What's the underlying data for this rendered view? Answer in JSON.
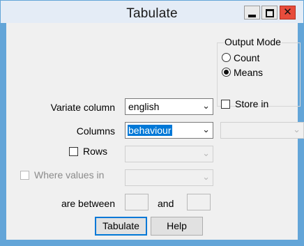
{
  "window": {
    "title": "Tabulate",
    "close_glyph": "✕"
  },
  "output_mode": {
    "label": "Output Mode",
    "options": [
      {
        "label": "Count",
        "checked": false
      },
      {
        "label": "Means",
        "checked": true
      }
    ]
  },
  "form": {
    "variate_column": {
      "label": "Variate column",
      "value": "english"
    },
    "store_in": {
      "label": "Store in",
      "checked": false
    },
    "columns": {
      "label": "Columns",
      "value": "behaviour"
    },
    "rows": {
      "label": "Rows",
      "checked": false
    },
    "where_values_in": {
      "label": "Where values in",
      "checked": false
    },
    "are_between": {
      "label": "are between",
      "and_label": "and"
    }
  },
  "buttons": {
    "tabulate": "Tabulate",
    "help": "Help"
  },
  "icons": {
    "dropdown_arrow": "⌄"
  }
}
